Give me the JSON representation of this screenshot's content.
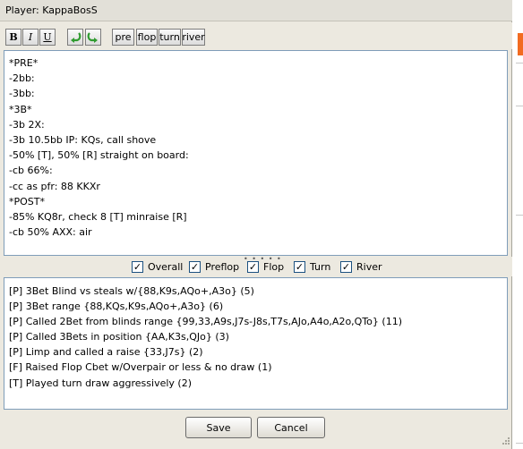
{
  "window": {
    "title": "Player: KappaBosS"
  },
  "toolbar": {
    "bold_label": "B",
    "italic_label": "I",
    "underline_label": "U",
    "undo_icon": "undo-arrow-icon",
    "redo_icon": "redo-arrow-icon",
    "pre_label": "pre",
    "flop_label": "flop",
    "turn_label": "turn",
    "river_label": "river"
  },
  "notes": {
    "lines": [
      "*PRE*",
      "-2bb:",
      "-3bb:",
      "*3B*",
      "-3b 2X:",
      "-3b 10.5bb IP: KQs, call shove",
      "-50% [T], 50% [R] straight on board:",
      "-cb 66%:",
      "-cc as pfr: 88 KKXr",
      "*POST*",
      "-85% KQ8r, check 8 [T] minraise [R]",
      "-cb 50% AXX: air"
    ]
  },
  "filters": {
    "overall": {
      "label": "Overall",
      "checked": true
    },
    "preflop": {
      "label": "Preflop",
      "checked": true
    },
    "flop": {
      "label": "Flop",
      "checked": true
    },
    "turn": {
      "label": "Turn",
      "checked": true
    },
    "river": {
      "label": "River",
      "checked": true
    }
  },
  "stats": {
    "lines": [
      "[P] 3Bet Blind vs steals w/{88,K9s,AQo+,A3o} (5)",
      "[P] 3Bet range {88,KQs,K9s,AQo+,A3o} (6)",
      "[P] Called 2Bet from blinds range {99,33,A9s,J7s-J8s,T7s,AJo,A4o,A2o,QTo} (11)",
      "[P] Called 3Bets in position {AA,K3s,QJo} (3)",
      "[P] Limp and called a raise {33,J7s} (2)",
      "[F] Raised Flop Cbet w/Overpair or less & no draw (1)",
      "[T] Played turn draw aggressively (2)"
    ]
  },
  "buttons": {
    "save_label": "Save",
    "cancel_label": "Cancel"
  },
  "colors": {
    "window_bg": "#ece9e0",
    "field_border": "#7f9db9",
    "undo_redo_green": "#2f9b2f",
    "side_accent": "#f26b21"
  }
}
